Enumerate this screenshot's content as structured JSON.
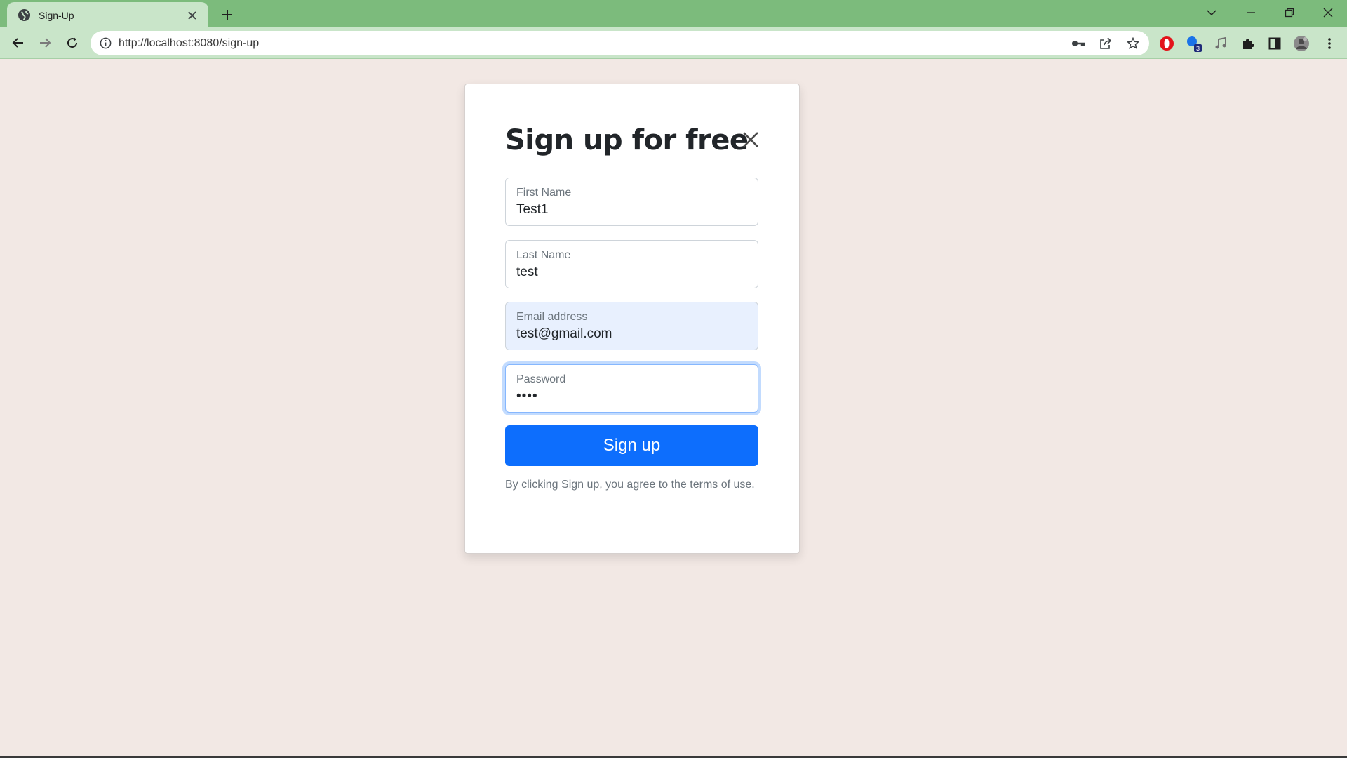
{
  "browser": {
    "tab_title": "Sign-Up",
    "url": "http://localhost:8080/sign-up",
    "extension_badge": "3",
    "colors": {
      "frame": "#7cbb7c",
      "toolbar": "#c9e5c9"
    }
  },
  "form": {
    "heading": "Sign up for free",
    "fields": [
      {
        "label": "First Name",
        "value": "Test1"
      },
      {
        "label": "Last Name",
        "value": "test"
      },
      {
        "label": "Email address",
        "value": "test@gmail.com"
      },
      {
        "label": "Password",
        "value": "••••"
      }
    ],
    "submit_label": "Sign up",
    "terms_text": "By clicking Sign up, you agree to the terms of use.",
    "colors": {
      "primary": "#0d6efd",
      "page_bg": "#f2e8e4",
      "autofill_bg": "#e8f0fe"
    }
  }
}
